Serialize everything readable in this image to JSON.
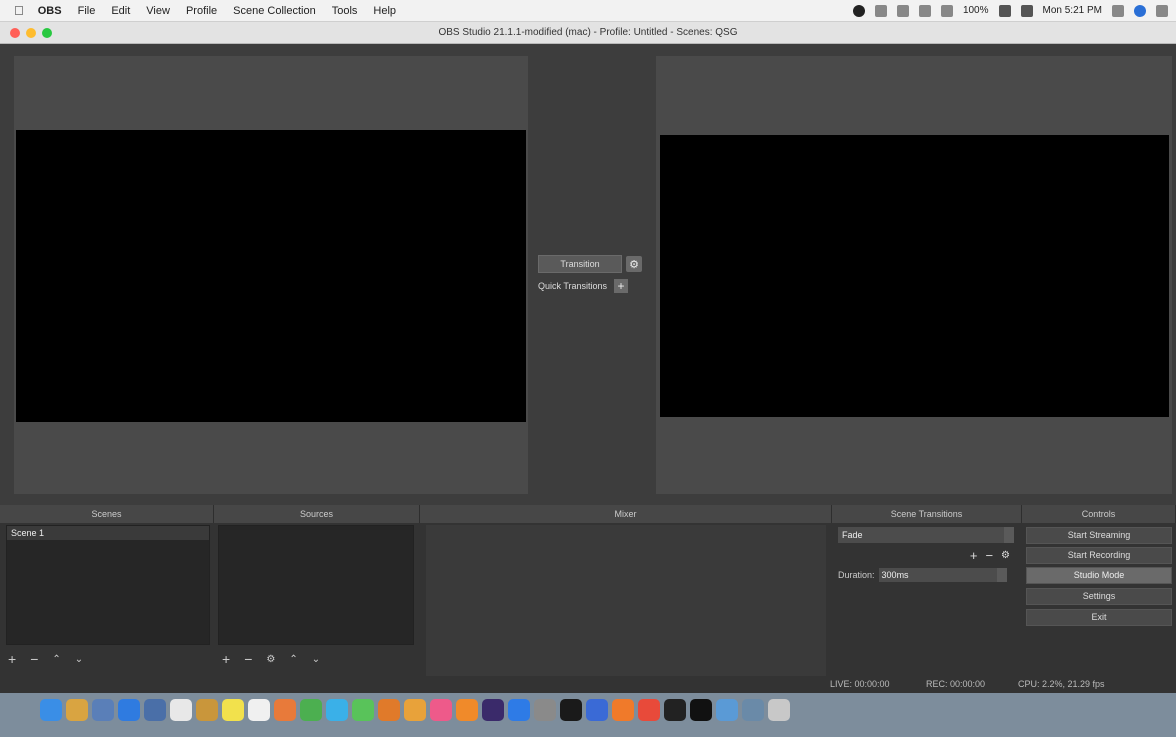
{
  "menubar": {
    "app_name": "OBS",
    "items": [
      "File",
      "Edit",
      "View",
      "Profile",
      "Scene Collection",
      "Tools",
      "Help"
    ],
    "battery": "100%",
    "clock": "Mon 5:21 PM"
  },
  "window": {
    "title": "OBS Studio 21.1.1-modified (mac) - Profile: Untitled - Scenes: QSG"
  },
  "center": {
    "transition_label": "Transition",
    "quick_transitions_label": "Quick Transitions"
  },
  "docks": {
    "scenes": {
      "header": "Scenes",
      "items": [
        "Scene 1"
      ]
    },
    "sources": {
      "header": "Sources"
    },
    "mixer": {
      "header": "Mixer"
    },
    "scene_transitions": {
      "header": "Scene Transitions",
      "selected": "Fade",
      "duration_label": "Duration",
      "duration_value": "300ms"
    },
    "controls": {
      "header": "Controls",
      "buttons": [
        "Start Streaming",
        "Start Recording",
        "Studio Mode",
        "Settings",
        "Exit"
      ]
    }
  },
  "status": {
    "live": "LIVE: 00:00:00",
    "rec": "REC: 00:00:00",
    "cpu": "CPU: 2.2%, 21.29 fps"
  },
  "dock_apps": [
    "finder-icon",
    "contacts-icon",
    "launchpad-icon",
    "safari-icon",
    "preview-icon",
    "calendar-icon",
    "notes-icon",
    "stickies-icon",
    "textedit-icon",
    "photos-icon",
    "numbers-icon",
    "messages-icon",
    "facetime-icon",
    "pages-icon",
    "keynote-icon",
    "itunes-icon",
    "books-icon",
    "premiere-icon",
    "appstore-icon",
    "system-prefs-icon",
    "terminal-icon",
    "xcode-icon",
    "compass-icon",
    "chrome-icon",
    "terminal2-icon",
    "obs-icon",
    "mail-icon",
    "downloads-icon",
    "trash-icon"
  ],
  "colors": {
    "dock_bg": "#7d8d9c",
    "panel_bg": "#3d3d3d",
    "preview_bg": "#000000"
  }
}
